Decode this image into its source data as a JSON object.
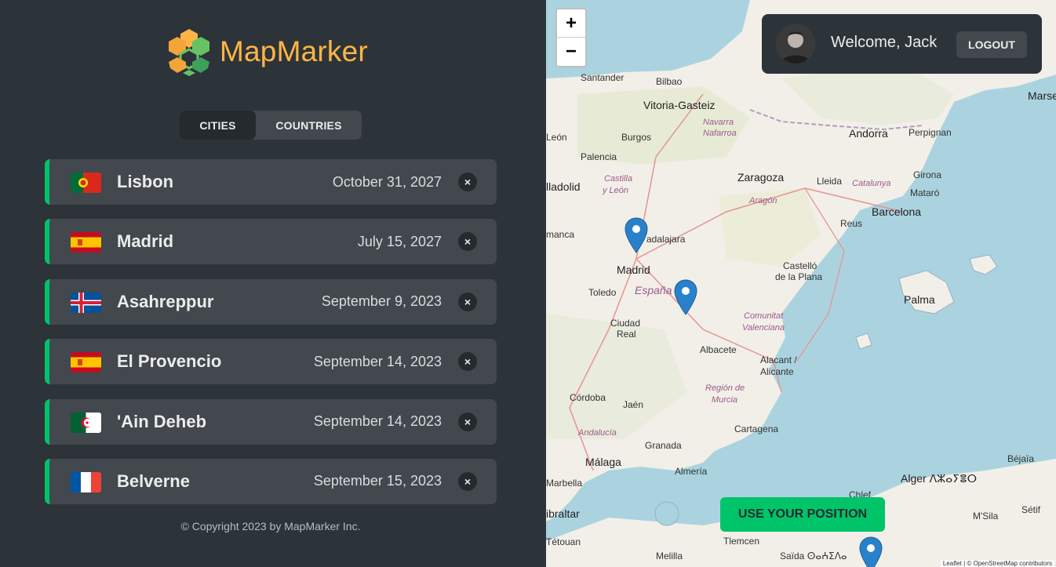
{
  "app": {
    "name": "MapMarker",
    "logo_color": "#ffb545",
    "accent": "#00c46a"
  },
  "tabs": [
    {
      "label": "CITIES",
      "active": true
    },
    {
      "label": "COUNTRIES",
      "active": false
    }
  ],
  "cities": [
    {
      "name": "Lisbon",
      "date": "October 31, 2027",
      "flag": "portugal"
    },
    {
      "name": "Madrid",
      "date": "July 15, 2027",
      "flag": "spain"
    },
    {
      "name": "Asahreppur",
      "date": "September 9, 2023",
      "flag": "iceland"
    },
    {
      "name": "El Provencio",
      "date": "September 14, 2023",
      "flag": "spain"
    },
    {
      "name": "'Ain Deheb",
      "date": "September 14, 2023",
      "flag": "algeria"
    },
    {
      "name": "Belverne",
      "date": "September 15, 2023",
      "flag": "france"
    }
  ],
  "delete_icon": "×",
  "copyright": "© Copyright 2023 by MapMarker Inc.",
  "map": {
    "zoom_in": "+",
    "zoom_out": "−",
    "user": {
      "welcome": "Welcome, Jack",
      "logout_label": "LOGOUT"
    },
    "use_position_label": "USE YOUR POSITION",
    "attribution": "Leaflet | © OpenStreetMap contributors",
    "labels": {
      "santander": "Santander",
      "bilbao": "Bilbao",
      "vitoria": "Vitoria-Gasteiz",
      "navarra": "Navarra",
      "nafarroa": "Nafarroa",
      "leon": "León",
      "burgos": "Burgos",
      "andorra": "Andorra",
      "perpignan": "Perpignan",
      "marseille": "Marseil",
      "palencia": "Palencia",
      "zaragoza": "Zaragoza",
      "lleida": "Lleida",
      "catalunya": "Catalunya",
      "girona": "Girona",
      "mataro": "Mataró",
      "valladolid": "lladolid",
      "castilla": "Castilla",
      "yleon": "y León",
      "aragon": "Aragón",
      "barcelona": "Barcelona",
      "reus": "Reus",
      "manca": "manca",
      "guadalajara": "adalajara",
      "madrid": "Madrid",
      "castello": "Castelló",
      "delaplana": "de la Plana",
      "toledo": "Toledo",
      "espana": "España",
      "palma": "Palma",
      "ciudad": "Ciudad",
      "real": "Real",
      "comunitat": "Comunitat",
      "valenciana": "Valenciana",
      "albacete": "Albacete",
      "alacant": "Alacant /",
      "alicante": "Alicante",
      "region": "Región de",
      "murcia": "Murcia",
      "cordoba": "Córdoba",
      "jaen": "Jaén",
      "cartagena": "Cartagena",
      "andalucia": "Andalucía",
      "granada": "Granada",
      "malaga": "Málaga",
      "almeria": "Almería",
      "marbella": "Marbella",
      "bejaia": "Béjaïa",
      "alger": "Alger ⴷⵣⴰⵢⴻⵔ",
      "chlef": "Chlef",
      "msila": "M'Sila",
      "setif": "Sétif",
      "gibraltar": "ibraltar",
      "tetouan": "Tétouan",
      "tlemcen": "Tlemcen",
      "melilla": "Melilla",
      "saida": "Saïda ⵙⴰⵄⵉⴷⴰ"
    }
  }
}
